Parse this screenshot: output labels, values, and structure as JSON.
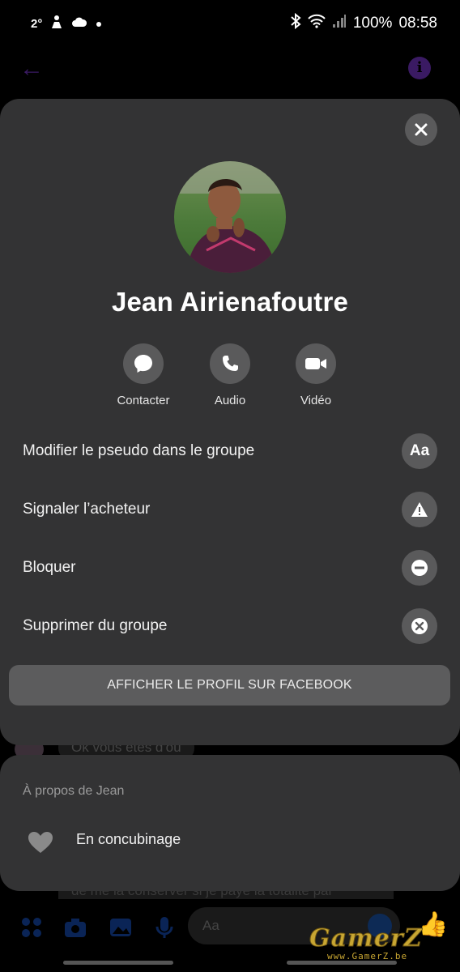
{
  "status_bar": {
    "temperature": "2°",
    "battery": "100%",
    "time": "08:58",
    "icons": [
      "person-icon",
      "cloud-icon",
      "dot-icon",
      "bluetooth-icon",
      "wifi-icon",
      "signal-icon"
    ]
  },
  "background": {
    "message_1": "Ok vous êtes d'où",
    "message_2": "de me la conserver si je paye la totalité par",
    "input_placeholder": "Aa",
    "accent_color": "#6a2fb5"
  },
  "profile": {
    "name": "Jean Airienafoutre",
    "actions": [
      {
        "label": "Contacter",
        "icon": "messenger-icon"
      },
      {
        "label": "Audio",
        "icon": "phone-icon"
      },
      {
        "label": "Vidéo",
        "icon": "video-icon"
      }
    ],
    "menu": [
      {
        "label": "Modifier le pseudo dans le groupe",
        "icon": "nickname-icon",
        "icon_text": "Aa"
      },
      {
        "label": "Signaler l’acheteur",
        "icon": "warning-icon"
      },
      {
        "label": "Bloquer",
        "icon": "block-icon"
      },
      {
        "label": "Supprimer du groupe",
        "icon": "remove-icon"
      }
    ],
    "facebook_button": "AFFICHER LE PROFIL SUR FACEBOOK"
  },
  "about": {
    "title": "À propos de Jean",
    "relationship": "En concubinage",
    "icon": "heart-icon"
  },
  "watermark": {
    "brand": "GamerZ",
    "url": "www.GamerZ.be"
  }
}
